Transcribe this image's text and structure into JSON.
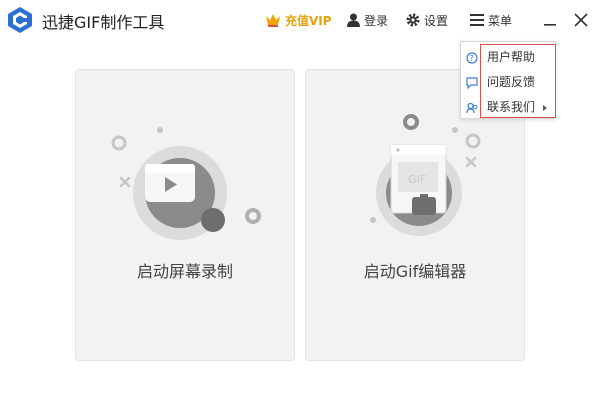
{
  "app": {
    "title": "迅捷GIF制作工具"
  },
  "toolbar": {
    "vip_label": "充值VIP",
    "login_label": "登录",
    "settings_label": "设置",
    "menu_label": "菜单"
  },
  "cards": {
    "record_label": "启动屏幕录制",
    "gif_editor_label": "启动Gif编辑器"
  },
  "dropdown": {
    "items": [
      {
        "label": "用户帮助",
        "icon": "help-icon"
      },
      {
        "label": "问题反馈",
        "icon": "feedback-icon"
      },
      {
        "label": "联系我们",
        "icon": "contact-icon",
        "has_submenu": true
      }
    ]
  },
  "colors": {
    "accent": "#3b7dd8",
    "vip": "#e8a20b",
    "highlight_border": "#d9534f",
    "card_bg": "#f2f2f2"
  }
}
